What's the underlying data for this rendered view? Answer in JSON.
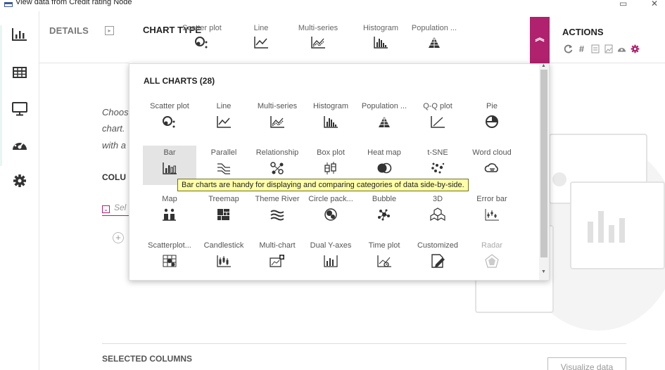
{
  "window": {
    "title": "View data from Credit rating Node",
    "minimize": "▭",
    "close": "✕"
  },
  "details_tab": {
    "label": "DETAILS"
  },
  "background": {
    "hint_lines": [
      "Choos",
      "chart.",
      "with a"
    ],
    "columns_heading": "COLU",
    "select_placeholder": "Sel",
    "selected_columns": "SELECTED COLUMNS",
    "visualize_button": "Visualize data"
  },
  "chart_type": {
    "title": "CHART TYPE",
    "recent": [
      {
        "label": "Scatter plot",
        "icon": "scatter-icon"
      },
      {
        "label": "Line",
        "icon": "line-icon"
      },
      {
        "label": "Multi-series",
        "icon": "multi-series-icon"
      },
      {
        "label": "Histogram",
        "icon": "histogram-icon"
      },
      {
        "label": "Population ...",
        "icon": "population-icon"
      }
    ]
  },
  "actions": {
    "title": "ACTIONS",
    "icons": [
      "refresh-icon",
      "hash-icon",
      "document-icon",
      "image-icon",
      "dashboard-icon",
      "settings-icon"
    ]
  },
  "all_charts": {
    "title": "ALL CHARTS (28)",
    "items": [
      {
        "label": "Scatter plot",
        "icon": "scatter-icon"
      },
      {
        "label": "Line",
        "icon": "line-icon"
      },
      {
        "label": "Multi-series",
        "icon": "multi-series-icon"
      },
      {
        "label": "Histogram",
        "icon": "histogram-icon"
      },
      {
        "label": "Population ...",
        "icon": "population-icon"
      },
      {
        "label": "Q-Q plot",
        "icon": "qq-plot-icon"
      },
      {
        "label": "Pie",
        "icon": "pie-icon"
      },
      {
        "label": "Bar",
        "icon": "bar-icon"
      },
      {
        "label": "Parallel",
        "icon": "parallel-icon"
      },
      {
        "label": "Relationship",
        "icon": "relationship-icon"
      },
      {
        "label": "Box plot",
        "icon": "box-plot-icon"
      },
      {
        "label": "Heat map",
        "icon": "heat-map-icon"
      },
      {
        "label": "t-SNE",
        "icon": "tsne-icon"
      },
      {
        "label": "Word cloud",
        "icon": "word-cloud-icon"
      },
      {
        "label": "Map",
        "icon": "map-icon"
      },
      {
        "label": "Treemap",
        "icon": "treemap-icon"
      },
      {
        "label": "Theme River",
        "icon": "theme-river-icon"
      },
      {
        "label": "Circle pack...",
        "icon": "circle-pack-icon"
      },
      {
        "label": "Bubble",
        "icon": "bubble-icon"
      },
      {
        "label": "3D",
        "icon": "3d-icon"
      },
      {
        "label": "Error bar",
        "icon": "error-bar-icon"
      },
      {
        "label": "Scatterplot...",
        "icon": "scatterplot-matrix-icon"
      },
      {
        "label": "Candlestick",
        "icon": "candlestick-icon"
      },
      {
        "label": "Multi-chart",
        "icon": "multi-chart-icon"
      },
      {
        "label": "Dual Y-axes",
        "icon": "dual-y-axes-icon"
      },
      {
        "label": "Time plot",
        "icon": "time-plot-icon"
      },
      {
        "label": "Customized",
        "icon": "customized-icon"
      },
      {
        "label": "Radar",
        "icon": "radar-icon"
      }
    ],
    "selected": "Bar",
    "tooltip": "Bar charts are handy for displaying and comparing categories of data side-by-side."
  },
  "colors": {
    "accent": "#b0216e",
    "icon_dark": "#333333",
    "tooltip_bg": "#ffffa8"
  }
}
